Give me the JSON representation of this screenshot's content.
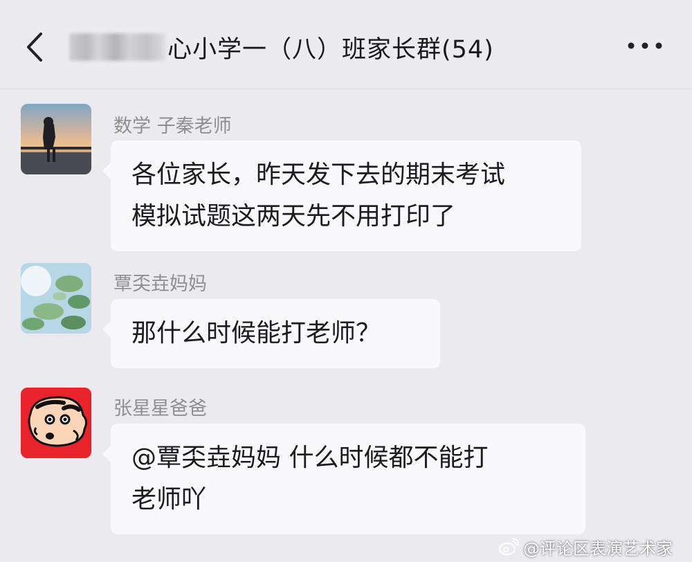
{
  "header": {
    "title": "心小学一（八）班家长群(54)"
  },
  "messages": [
    {
      "sender": "数学 子秦老师",
      "lines": [
        "各位家长，昨天发下去的期末考试",
        "模拟试题这两天先不用打印了"
      ]
    },
    {
      "sender": "覃奀垚妈妈",
      "lines": [
        "那什么时候能打老师？"
      ]
    },
    {
      "sender": "张星星爸爸",
      "lines": [
        "@覃奀垚妈妈 什么时候都不能打",
        "老师吖"
      ]
    }
  ],
  "watermark": {
    "text": "@评论区表演艺术家",
    "icon": "weibo-icon"
  },
  "icons": {
    "back": "chevron-left-icon",
    "more": "more-dots-icon"
  },
  "colors": {
    "background": "#ebebef",
    "bubble": "#f9f9fb",
    "sender_name": "#8f8f8f",
    "avatar_red": "#e8232b"
  }
}
